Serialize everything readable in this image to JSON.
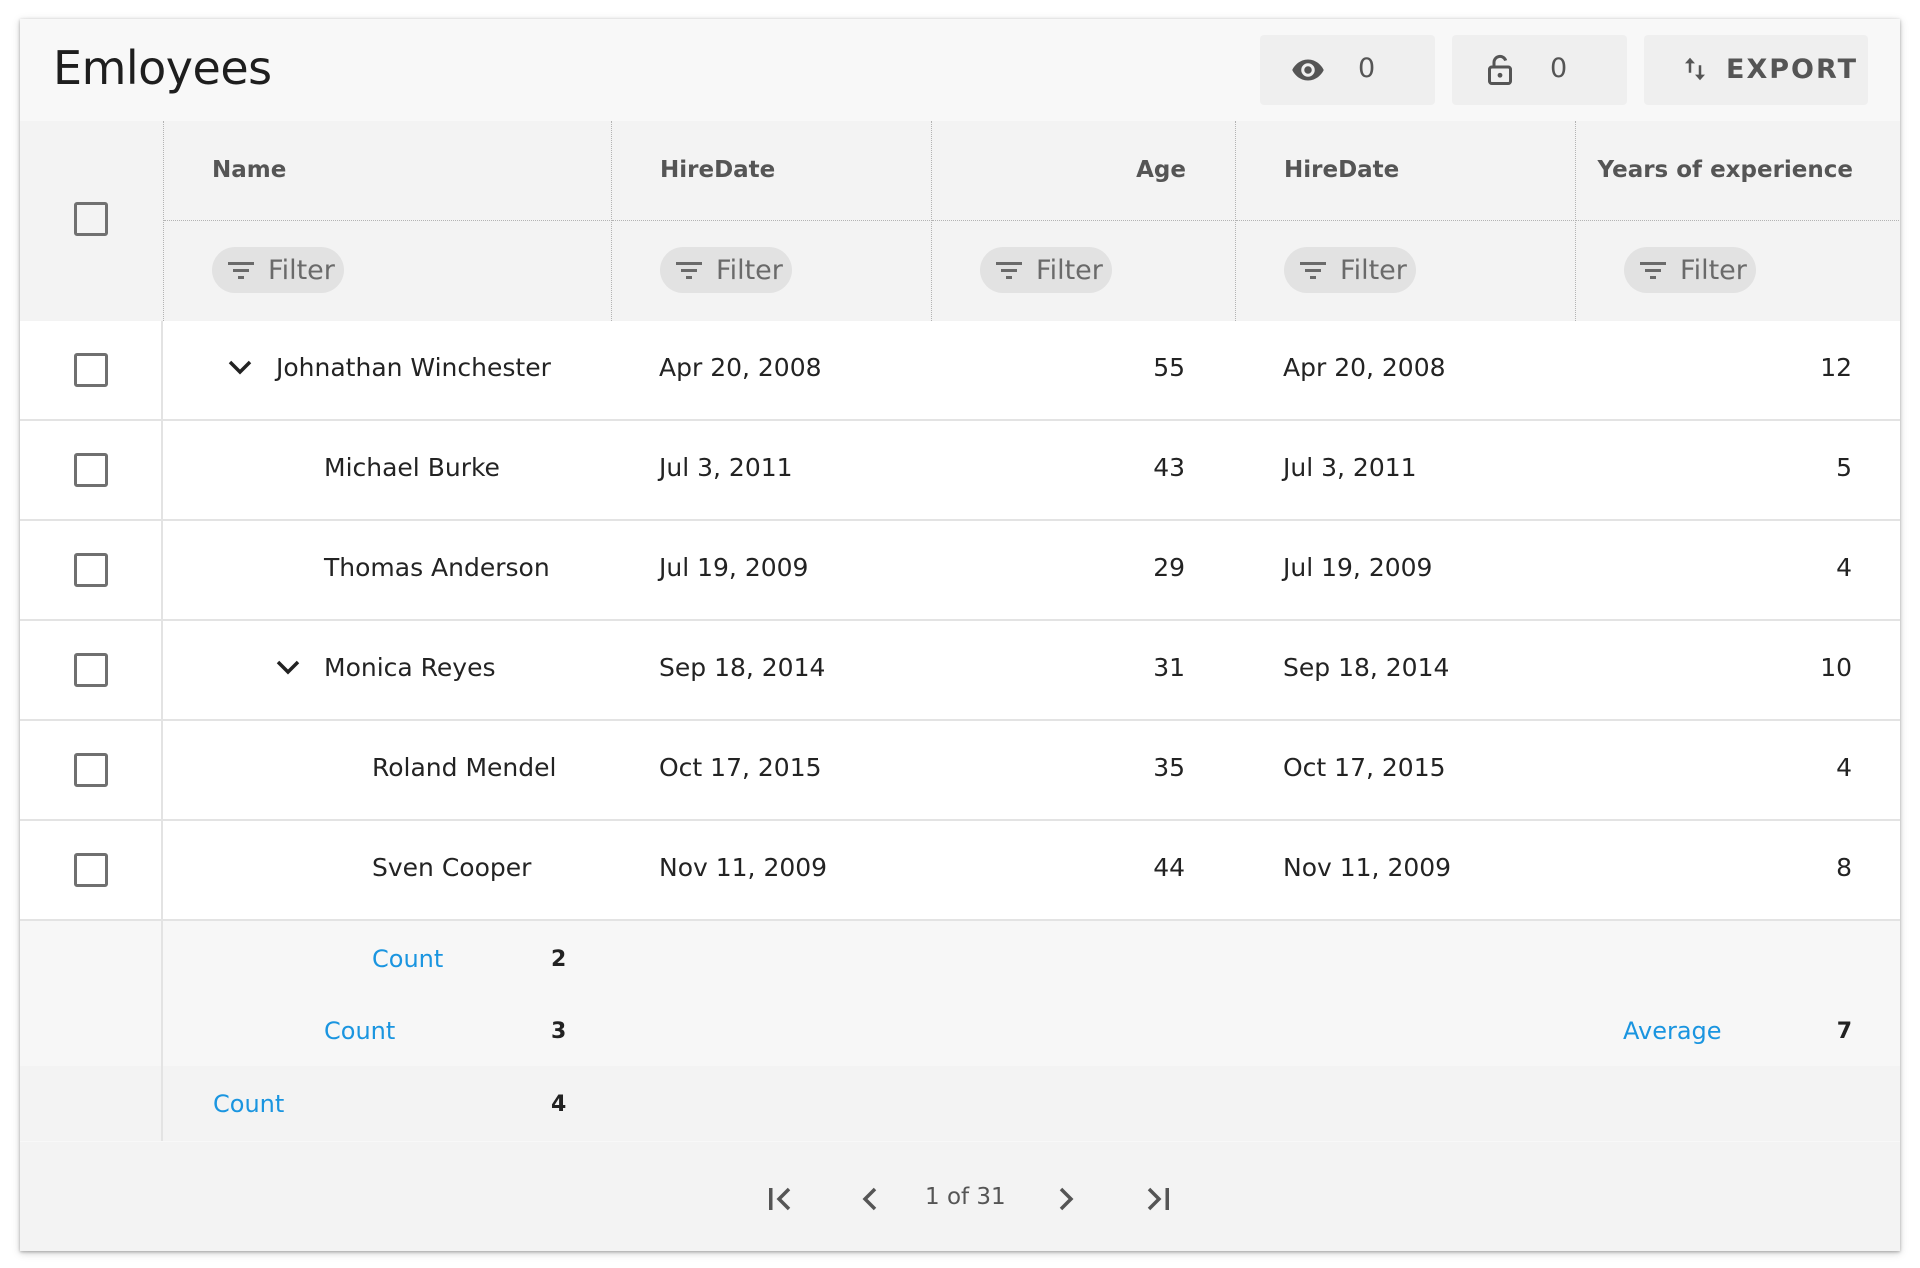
{
  "toolbar": {
    "title": "Emloyees",
    "visible_count": "0",
    "locked_count": "0",
    "export_label": "EXPORT"
  },
  "columns": [
    {
      "label": "Name",
      "filter": "Filter"
    },
    {
      "label": "HireDate",
      "filter": "Filter"
    },
    {
      "label": "Age",
      "filter": "Filter"
    },
    {
      "label": "HireDate",
      "filter": "Filter"
    },
    {
      "label": "Years of experience",
      "filter": "Filter"
    }
  ],
  "rows": [
    {
      "name": "Johnathan Winchester",
      "hire": "Apr 20, 2008",
      "age": "55",
      "hire2": "Apr 20, 2008",
      "years": "12",
      "expanded": true,
      "level": 0
    },
    {
      "name": "Michael Burke",
      "hire": "Jul 3, 2011",
      "age": "43",
      "hire2": "Jul 3, 2011",
      "years": "5",
      "level": 1
    },
    {
      "name": "Thomas Anderson",
      "hire": "Jul 19, 2009",
      "age": "29",
      "hire2": "Jul 19, 2009",
      "years": "4",
      "level": 1
    },
    {
      "name": "Monica Reyes",
      "hire": "Sep 18, 2014",
      "age": "31",
      "hire2": "Sep 18, 2014",
      "years": "10",
      "expanded": true,
      "level": 1
    },
    {
      "name": "Roland Mendel",
      "hire": "Oct 17, 2015",
      "age": "35",
      "hire2": "Oct 17, 2015",
      "years": "4",
      "level": 2
    },
    {
      "name": "Sven Cooper",
      "hire": "Nov 11, 2009",
      "age": "44",
      "hire2": "Nov 11, 2009",
      "years": "8",
      "level": 2
    }
  ],
  "summaries": [
    {
      "label": "Count",
      "value": "2"
    },
    {
      "label": "Count",
      "value": "3",
      "avg_label": "Average",
      "avg_value": "7"
    },
    {
      "label": "Count",
      "value": "4"
    }
  ],
  "pager": {
    "text": "1 of 31"
  },
  "colors": {
    "accent": "#1a95e0",
    "card_bg": "#f8f8f8",
    "header_bg": "#f3f3f3"
  }
}
